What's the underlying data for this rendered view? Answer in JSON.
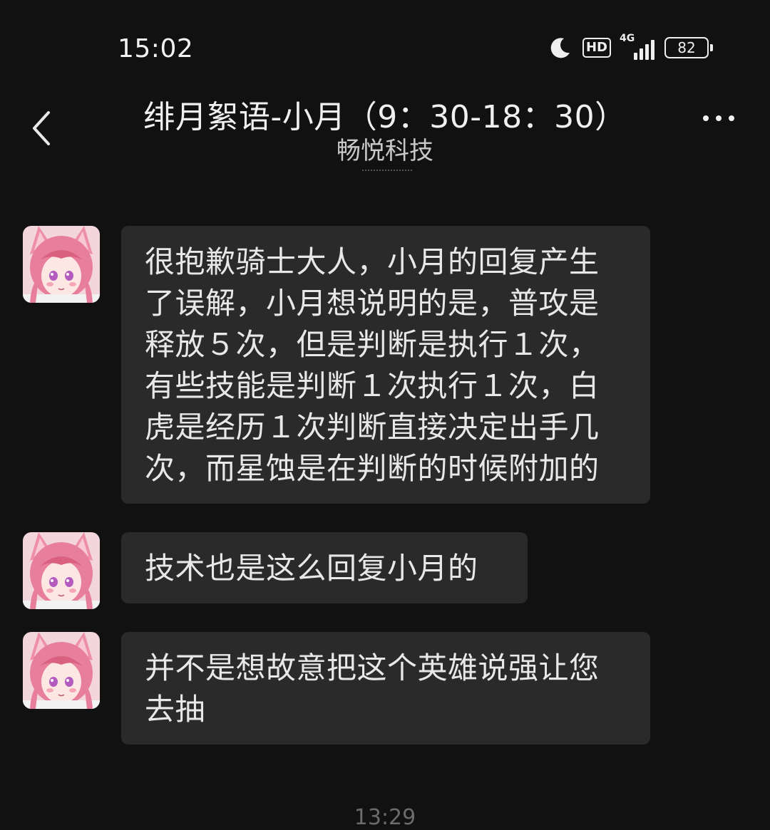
{
  "status_bar": {
    "time": "15:02",
    "hd_label": "HD",
    "network_label": "4G",
    "battery_level": "82"
  },
  "header": {
    "title": "绯月絮语-小月（9：30-18：30）",
    "subtitle": "畅悦科技"
  },
  "messages": [
    {
      "text": "很抱歉骑士大人，小月的回复产生了误解，小月想说明的是，普攻是释放５次，但是判断是执行１次，有些技能是判断１次执行１次，白虎是经历１次判断直接决定出手几次，而星蚀是在判断的时候附加的"
    },
    {
      "text": "技术也是这么回复小月的"
    },
    {
      "text": "并不是想故意把这个英雄说强让您去抽"
    }
  ],
  "timestamp": "13:29",
  "icons": {
    "back": "chevron-left-icon",
    "more": "more-dots-icon",
    "dnd": "moon-icon"
  },
  "colors": {
    "background": "#111111",
    "bubble": "#2a2a2a",
    "text": "#e8e8e8"
  }
}
